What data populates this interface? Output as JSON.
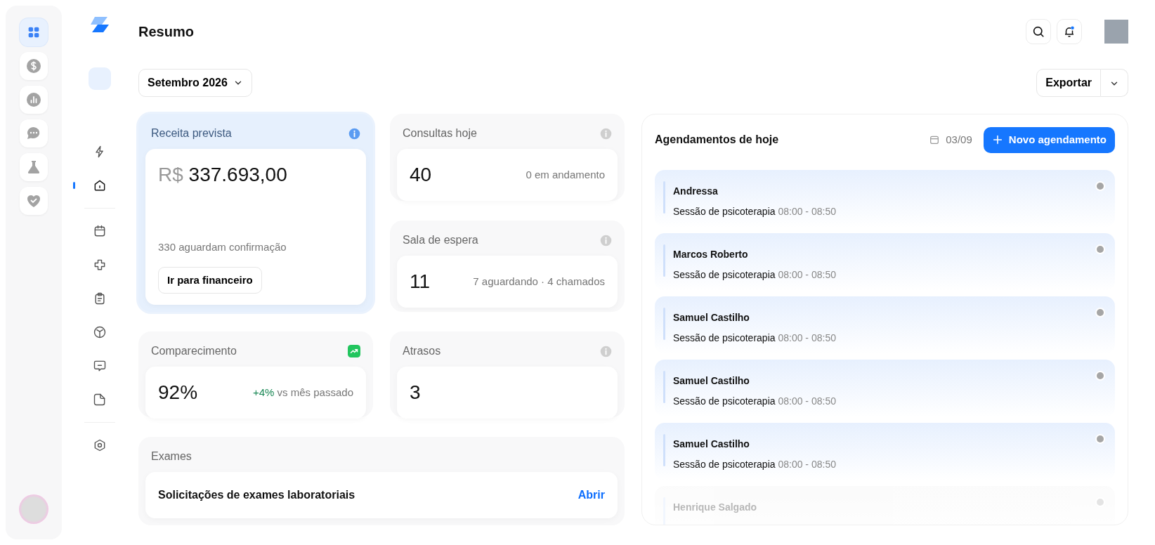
{
  "rail": [
    {
      "kind": "grid",
      "selected": true
    },
    {
      "kind": "dollar",
      "selected": false
    },
    {
      "kind": "chart",
      "selected": false
    },
    {
      "kind": "chat",
      "selected": false
    },
    {
      "kind": "flask",
      "selected": false
    },
    {
      "kind": "heart",
      "selected": false
    }
  ],
  "nav_groups": [
    [
      {
        "kind": "bolt",
        "selected": false
      },
      {
        "kind": "home",
        "selected": true
      }
    ],
    [
      {
        "kind": "calendar",
        "selected": false
      },
      {
        "kind": "cross",
        "selected": false
      },
      {
        "kind": "clipboard",
        "selected": false
      },
      {
        "kind": "box",
        "selected": false
      },
      {
        "kind": "message",
        "selected": false
      },
      {
        "kind": "note",
        "selected": false
      }
    ],
    [
      {
        "kind": "settings",
        "selected": false
      }
    ]
  ],
  "header": {
    "title": "Resumo"
  },
  "period": {
    "value": "Setembro 2026"
  },
  "export_button": "Exportar",
  "revenue": {
    "title": "Receita prevista",
    "currency": "R$",
    "amount": "337.693,00",
    "note": "330 aguardam confirmação",
    "button": "Ir para financeiro"
  },
  "stats": [
    {
      "title": "Consultas hoje",
      "value": "40",
      "detail": "0 em andamento"
    },
    {
      "title": "Sala de espera",
      "value": "11",
      "detail": "7 aguardando · 4 chamados"
    }
  ],
  "attendance": {
    "title": "Comparecimento",
    "value": "92%",
    "change": "+4%",
    "detail": "vs mês passado"
  },
  "delays": {
    "title": "Atrasos",
    "value": "3"
  },
  "exams": {
    "title": "Exames",
    "item": "Solicitações de exames laboratoriais",
    "link": "Abrir"
  },
  "appointments": {
    "title": "Agendamentos de hoje",
    "date": "03/09",
    "button": "Novo agendamento",
    "items": [
      {
        "name": "Andressa",
        "service": "Sessão de psicoterapia",
        "time": "08:00 - 08:50",
        "faded": false
      },
      {
        "name": "Marcos Roberto",
        "service": "Sessão de psicoterapia",
        "time": "08:00 - 08:50",
        "faded": false
      },
      {
        "name": "Samuel Castilho",
        "service": "Sessão de psicoterapia",
        "time": "08:00 - 08:50",
        "faded": false
      },
      {
        "name": "Samuel Castilho",
        "service": "Sessão de psicoterapia",
        "time": "08:00 - 08:50",
        "faded": false
      },
      {
        "name": "Samuel Castilho",
        "service": "Sessão de psicoterapia",
        "time": "08:00 - 08:50",
        "faded": false
      },
      {
        "name": "Henrique Salgado",
        "faded": true
      }
    ]
  }
}
